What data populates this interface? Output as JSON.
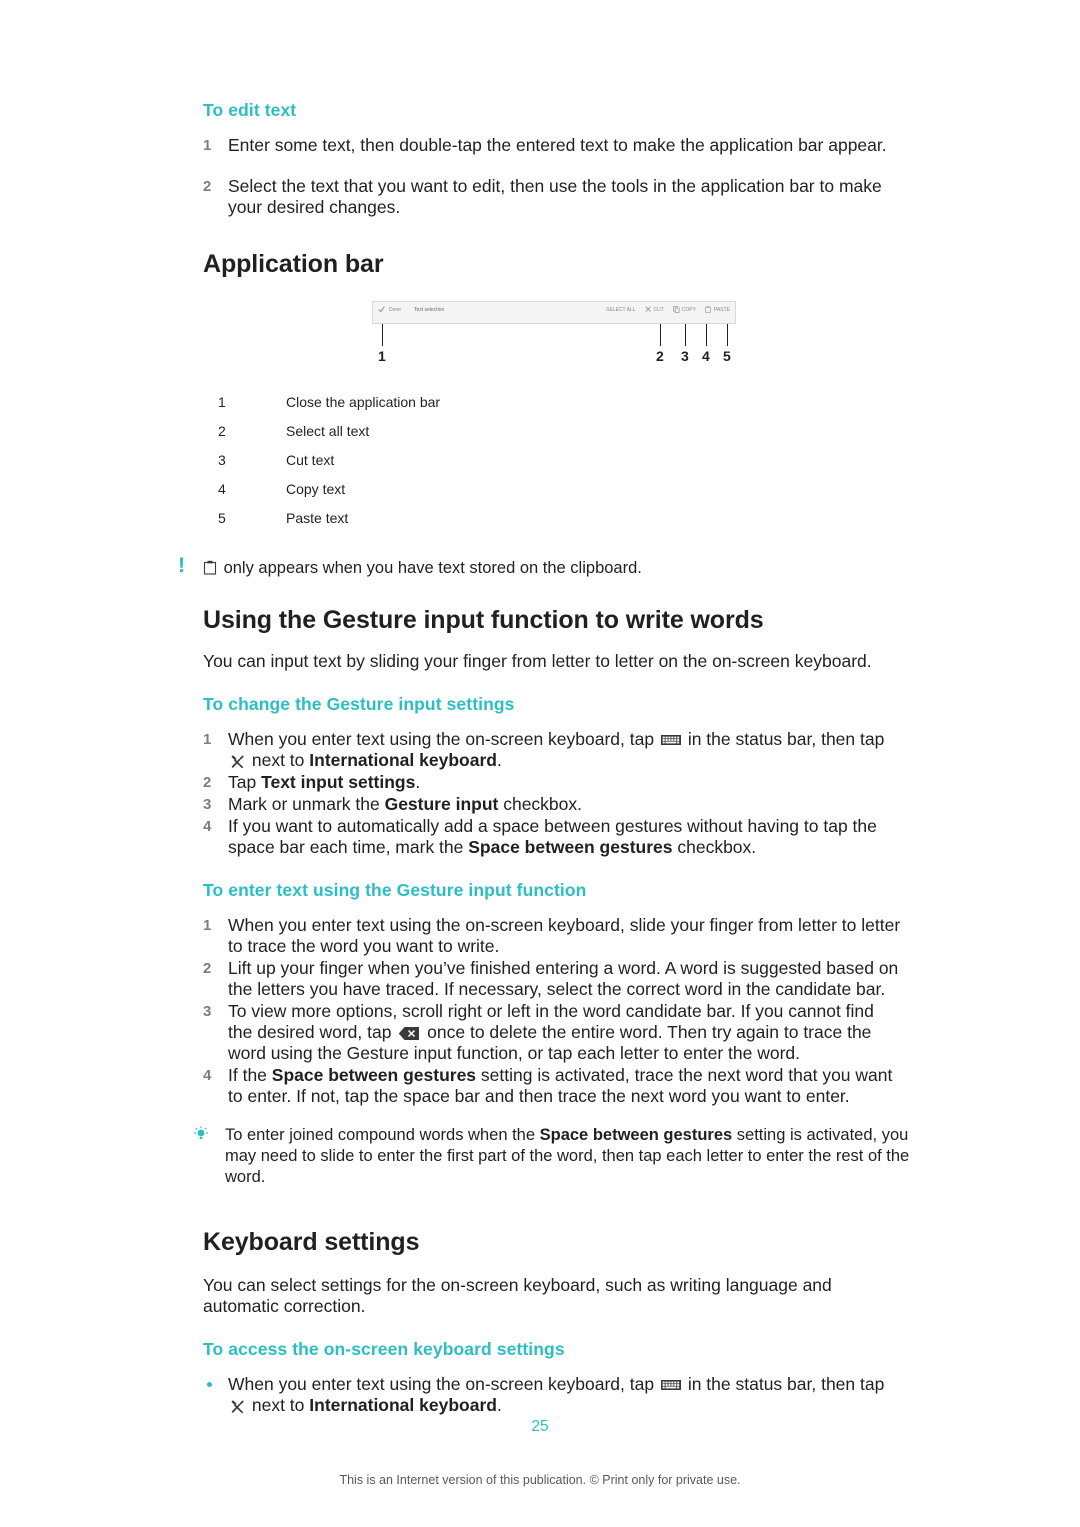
{
  "sections": {
    "to_edit_text": {
      "heading": "To edit text",
      "steps": [
        "Enter some text, then double-tap the entered text to make the application bar appear.",
        "Select the text that you want to edit, then use the tools in the application bar to make your desired changes."
      ]
    },
    "application_bar": {
      "heading": "Application bar",
      "figure": {
        "bar_left_labels": [
          "Done",
          "Text selection"
        ],
        "bar_right_labels": [
          "SELECT ALL",
          "CUT",
          "COPY",
          "PASTE"
        ],
        "callout_numbers": [
          "1",
          "2",
          "3",
          "4",
          "5"
        ]
      },
      "legend": [
        {
          "num": "1",
          "text": "Close the application bar"
        },
        {
          "num": "2",
          "text": "Select all text"
        },
        {
          "num": "3",
          "text": "Cut text"
        },
        {
          "num": "4",
          "text": "Copy text"
        },
        {
          "num": "5",
          "text": "Paste text"
        }
      ],
      "note": {
        "mark": "!",
        "text": " only appears when you have text stored on the clipboard."
      }
    },
    "gesture_input": {
      "heading": "Using the Gesture input function to write words",
      "intro": "You can input text by sliding your finger from letter to letter on the on-screen keyboard.",
      "change_settings": {
        "heading": "To change the Gesture input settings",
        "steps": [
          {
            "parts": [
              {
                "t": "When you enter text using the on-screen keyboard, tap ",
                "b": false
              },
              {
                "t": "ICON:keyboard",
                "b": false
              },
              {
                "t": " in the status bar, then tap ",
                "b": false
              },
              {
                "t": "ICON:wrench",
                "b": false
              },
              {
                "t": " next to ",
                "b": false
              },
              {
                "t": "International keyboard",
                "b": true
              },
              {
                "t": ".",
                "b": false
              }
            ]
          },
          {
            "parts": [
              {
                "t": "Tap ",
                "b": false
              },
              {
                "t": "Text input settings",
                "b": true
              },
              {
                "t": ".",
                "b": false
              }
            ]
          },
          {
            "parts": [
              {
                "t": "Mark or unmark the ",
                "b": false
              },
              {
                "t": "Gesture input",
                "b": true
              },
              {
                "t": " checkbox.",
                "b": false
              }
            ]
          },
          {
            "parts": [
              {
                "t": "If you want to automatically add a space between gestures without having to tap the space bar each time, mark the ",
                "b": false
              },
              {
                "t": "Space between gestures",
                "b": true
              },
              {
                "t": " checkbox.",
                "b": false
              }
            ]
          }
        ]
      },
      "enter_text": {
        "heading": "To enter text using the Gesture input function",
        "steps": [
          {
            "parts": [
              {
                "t": "When you enter text using the on-screen keyboard, slide your finger from letter to letter to trace the word you want to write.",
                "b": false
              }
            ]
          },
          {
            "parts": [
              {
                "t": "Lift up your finger when you’ve finished entering a word. A word is suggested based on the letters you have traced. If necessary, select the correct word in the candidate bar.",
                "b": false
              }
            ]
          },
          {
            "parts": [
              {
                "t": "To view more options, scroll right or left in the word candidate bar. If you cannot find the desired word, tap ",
                "b": false
              },
              {
                "t": "ICON:delete",
                "b": false
              },
              {
                "t": " once to delete the entire word. Then try again to trace the word using the Gesture input function, or tap each letter to enter the word.",
                "b": false
              }
            ]
          },
          {
            "parts": [
              {
                "t": "If the ",
                "b": false
              },
              {
                "t": "Space between gestures",
                "b": true
              },
              {
                "t": " setting is activated, trace the next word that you want to enter. If not, tap the space bar and then trace the next word you want to enter.",
                "b": false
              }
            ]
          }
        ],
        "tip": {
          "parts": [
            {
              "t": "To enter joined compound words when the ",
              "b": false
            },
            {
              "t": "Space between gestures",
              "b": true
            },
            {
              "t": " setting is activated, you may need to slide to enter the first part of the word, then tap each letter to enter the rest of the word.",
              "b": false
            }
          ]
        }
      }
    },
    "keyboard_settings": {
      "heading": "Keyboard settings",
      "intro": "You can select settings for the on-screen keyboard, such as writing language and automatic correction.",
      "access": {
        "heading": "To access the on-screen keyboard settings",
        "bullet": {
          "parts": [
            {
              "t": "When you enter text using the on-screen keyboard, tap ",
              "b": false
            },
            {
              "t": "ICON:keyboard",
              "b": false
            },
            {
              "t": " in the status bar, then tap ",
              "b": false
            },
            {
              "t": "ICON:wrench",
              "b": false
            },
            {
              "t": " next to ",
              "b": false
            },
            {
              "t": "International keyboard",
              "b": true
            },
            {
              "t": ".",
              "b": false
            }
          ]
        }
      }
    }
  },
  "page_number": "25",
  "footer": "This is an Internet version of this publication. © Print only for private use.",
  "colors": {
    "accent": "#2bbfc4",
    "text": "#231f20",
    "muted": "#7d7d7d"
  }
}
